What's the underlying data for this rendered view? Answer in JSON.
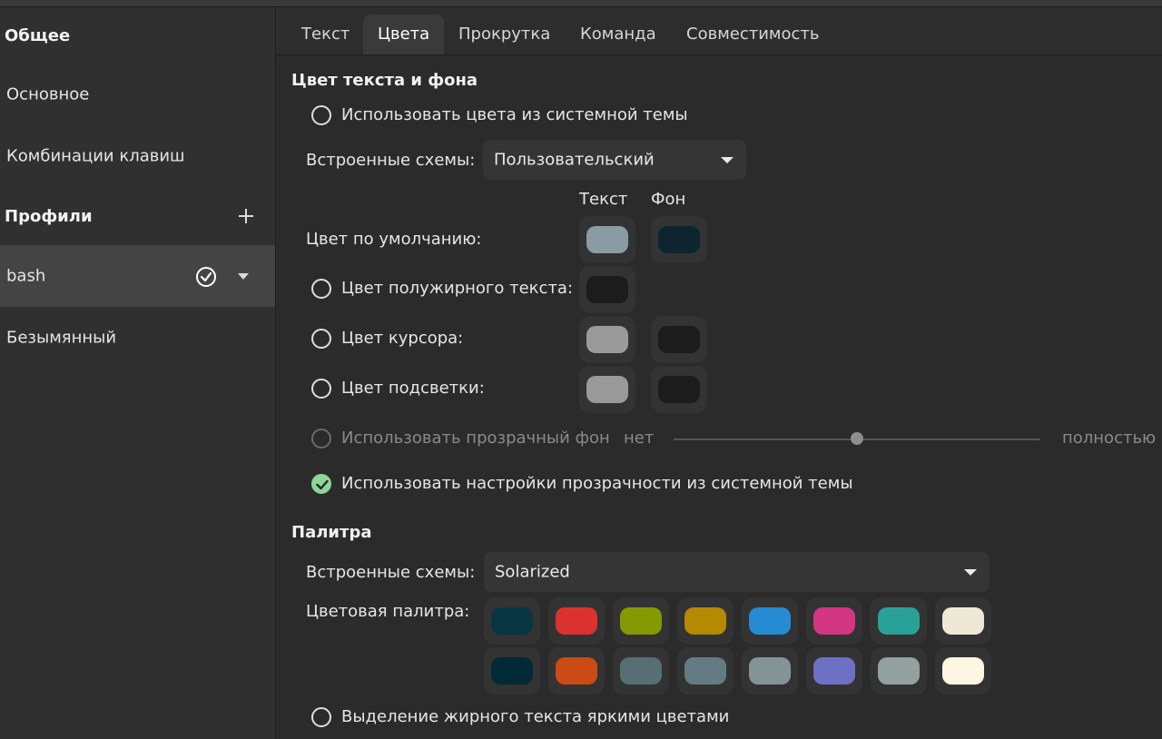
{
  "sidebar": {
    "general_heading": "Общее",
    "general_items": [
      "Основное",
      "Комбинации клавиш"
    ],
    "profiles_heading": "Профили",
    "profiles": [
      {
        "label": "bash",
        "selected": true
      },
      {
        "label": "Безымянный",
        "selected": false
      }
    ],
    "icons": {
      "add": "plus-icon",
      "default": "check-circle-icon",
      "menu": "chevron-down-icon"
    }
  },
  "tabs": [
    "Текст",
    "Цвета",
    "Прокрутка",
    "Команда",
    "Совместимость"
  ],
  "active_tab": "Цвета",
  "colors_section": {
    "title": "Цвет текста и фона",
    "use_system_theme_label": "Использовать цвета из системной темы",
    "builtin_schemes_label": "Встроенные схемы:",
    "builtin_scheme_value": "Пользовательский",
    "col_text": "Текст",
    "col_bg": "Фон",
    "default_color_label": "Цвет по умолчанию:",
    "bold_color_label": "Цвет полужирного текста:",
    "cursor_color_label": "Цвет курсора:",
    "highlight_color_label": "Цвет подсветки:",
    "transparent_bg_label": "Использовать прозрачный фон",
    "transparency_min_label": "нет",
    "transparency_max_label": "полностью",
    "transparency_level": 0.5,
    "use_theme_transparency_label": "Использовать настройки прозрачности из системной темы",
    "use_theme_transparency_checked": true,
    "swatches": {
      "default_text": "#8a9ba1",
      "default_bg": "#0d2530",
      "bold_text": "#1c1c1c",
      "cursor_text": "#9a9a9a",
      "cursor_bg": "#1c1c1c",
      "highlight_text": "#9a9a9a",
      "highlight_bg": "#1c1c1c"
    }
  },
  "palette_section": {
    "title": "Палитра",
    "builtin_schemes_label": "Встроенные схемы:",
    "builtin_scheme_value": "Solarized",
    "palette_label": "Цветовая палитра:",
    "row1": [
      "#073642",
      "#dc322f",
      "#859900",
      "#b58900",
      "#268bd2",
      "#d33682",
      "#2aa198",
      "#eee8d5"
    ],
    "row2": [
      "#002b36",
      "#cb4b16",
      "#586e75",
      "#657b83",
      "#839496",
      "#6c71c4",
      "#93a1a1",
      "#fdf6e3"
    ],
    "bright_bold_label": "Выделение жирного текста яркими цветами"
  }
}
